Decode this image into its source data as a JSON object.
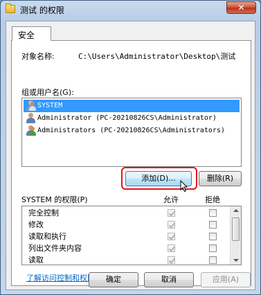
{
  "window": {
    "title": "测试 的权限",
    "close_glyph": "✕"
  },
  "tab": {
    "label": "安全"
  },
  "object": {
    "label": "对象名称:",
    "path": "C:\\Users\\Administrator\\Desktop\\测试"
  },
  "groups": {
    "label": "组或用户名(G):",
    "items": [
      {
        "label": "SYSTEM",
        "selected": true,
        "icon": "users-group-icon"
      },
      {
        "label": "Administrator (PC-20210826CS\\Administrator)",
        "selected": false,
        "icon": "user-icon"
      },
      {
        "label": "Administrators (PC-20210826CS\\Administrators)",
        "selected": false,
        "icon": "users-group-icon"
      }
    ]
  },
  "buttons": {
    "add": "添加(D)...",
    "remove": "删除(R)",
    "ok": "确定",
    "cancel": "取消",
    "apply": "应用(A)"
  },
  "permissions": {
    "label": "SYSTEM 的权限(P)",
    "allow_header": "允许",
    "deny_header": "拒绝",
    "rows": [
      {
        "name": "完全控制",
        "allow": true,
        "deny": false
      },
      {
        "name": "修改",
        "allow": true,
        "deny": false
      },
      {
        "name": "读取和执行",
        "allow": true,
        "deny": false
      },
      {
        "name": "列出文件夹内容",
        "allow": true,
        "deny": false
      },
      {
        "name": "读取",
        "allow": true,
        "deny": false
      }
    ]
  },
  "link": {
    "label": "了解访问控制和权限"
  },
  "colors": {
    "selection": "#3399ff",
    "highlight_ring": "#e8141b",
    "link": "#0066cc"
  }
}
